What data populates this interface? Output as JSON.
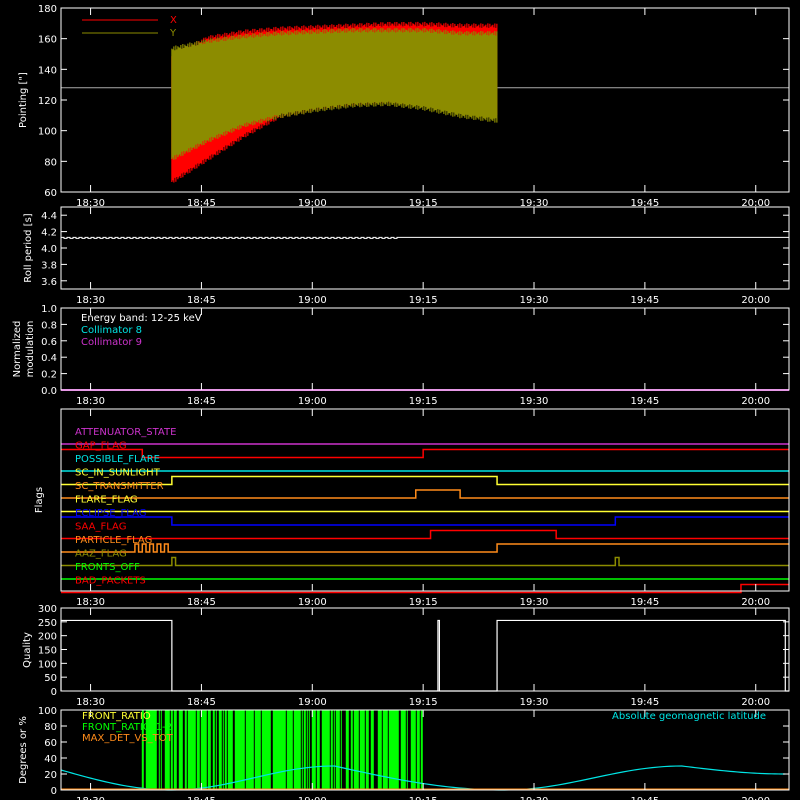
{
  "colors": {
    "background": "#000000",
    "axes": "#ffffff",
    "red": "#ff0000",
    "olive": "#8c8c00",
    "cyan": "#00e5e5",
    "magenta": "#cc33cc",
    "green": "#00ff00",
    "orange": "#ff8c1a",
    "yellow": "#ffff33",
    "blue": "#0000ff",
    "gray": "#aaaaaa"
  },
  "time_ticks": [
    "18:30",
    "18:45",
    "19:00",
    "19:15",
    "19:30",
    "19:45",
    "20:00"
  ],
  "chart_data": [
    {
      "type": "line",
      "ylabel": "Pointing [\"]",
      "ylim": [
        60,
        180
      ],
      "yticks": [
        "60",
        "80",
        "100",
        "120",
        "140",
        "160",
        "180"
      ],
      "legend": [
        "X",
        "Y"
      ],
      "reference_level": 128,
      "x_start": "18:41",
      "x_end": "19:25",
      "series": [
        {
          "name": "X",
          "color": "red",
          "low": [
            65,
            80,
            95,
            108,
            113,
            116,
            118,
            116,
            112,
            110
          ],
          "high": [
            150,
            162,
            166,
            168,
            169,
            170,
            171,
            171,
            170,
            170
          ]
        },
        {
          "name": "Y",
          "color": "olive",
          "low": [
            80,
            92,
            102,
            108,
            112,
            115,
            116,
            113,
            108,
            105
          ],
          "high": [
            155,
            160,
            163,
            165,
            166,
            167,
            167,
            167,
            165,
            165
          ]
        }
      ]
    },
    {
      "type": "line",
      "ylabel": "Roll period [s]",
      "ylim": [
        3.5,
        4.5
      ],
      "yticks": [
        "3.6",
        "3.8",
        "4.0",
        "4.2",
        "4.4"
      ],
      "value": 4.13
    },
    {
      "type": "line",
      "ylabel": "Normalized modulation",
      "ylabel_lines": [
        "Normalized",
        "modulation"
      ],
      "ylim": [
        0,
        1
      ],
      "yticks": [
        "0.0",
        "0.2",
        "0.4",
        "0.6",
        "0.8",
        "1.0"
      ],
      "legend": [
        "Energy band: 12-25 keV",
        "Collimator 8",
        "Collimator 9"
      ],
      "value": 0
    },
    {
      "type": "line",
      "ylabel": "Flags",
      "flags": [
        {
          "name": "ATTENUATOR_STATE",
          "color": "magenta",
          "transitions": []
        },
        {
          "name": "GAP_FLAG",
          "color": "red",
          "transitions": [
            "18:37",
            "19:15"
          ],
          "initial": 1
        },
        {
          "name": "POSSIBLE_FLARE",
          "color": "cyan",
          "transitions": []
        },
        {
          "name": "SC_IN_SUNLIGHT",
          "color": "yellow",
          "transitions": [
            "18:41",
            "19:25"
          ],
          "initial": 0
        },
        {
          "name": "SC_TRANSMITTER",
          "color": "orange",
          "transitions": [
            "19:14",
            "19:20"
          ],
          "initial": 0
        },
        {
          "name": "FLARE_FLAG",
          "color": "yellow",
          "transitions": []
        },
        {
          "name": "ECLIPSE_FLAG",
          "color": "blue",
          "transitions": [
            "18:41",
            "19:41"
          ],
          "initial": 1
        },
        {
          "name": "SAA_FLAG",
          "color": "red",
          "transitions": [
            "19:16",
            "19:33"
          ],
          "initial": 0
        },
        {
          "name": "PARTICLE_FLAG",
          "color": "orange",
          "transitions": [
            "18:36",
            "18:36.5",
            "18:37",
            "18:37.5",
            "18:38",
            "18:38.5",
            "18:39",
            "18:39.5",
            "18:40",
            "18:40.5",
            "19:25"
          ],
          "initial": 0
        },
        {
          "name": "AAZ_FLAG",
          "color": "olive",
          "transitions": [
            "18:41",
            "18:41.5",
            "19:41",
            "19:41.5"
          ],
          "initial": 0
        },
        {
          "name": "FRONTS_OFF",
          "color": "green",
          "transitions": []
        },
        {
          "name": "BAD_PACKETS",
          "color": "red",
          "transitions": [
            "19:58"
          ],
          "initial": 0
        }
      ]
    },
    {
      "type": "line",
      "ylabel": "Quality",
      "ylim": [
        0,
        300
      ],
      "yticks": [
        "0",
        "50",
        "100",
        "150",
        "200",
        "250",
        "300"
      ],
      "segments": [
        {
          "from": "18:26",
          "to": "18:41",
          "value": 255
        },
        {
          "from": "19:17",
          "to": "19:17.2",
          "value": 255
        },
        {
          "from": "19:25",
          "to": "20:04",
          "value": 255
        }
      ]
    },
    {
      "type": "line",
      "ylabel": "Degrees or %",
      "ylim": [
        0,
        100
      ],
      "yticks": [
        "0",
        "20",
        "40",
        "60",
        "80",
        "100"
      ],
      "legend": [
        "FRONT_RATIO",
        "FRONT_RATIO_1-2",
        "MAX_DET_VS_TOT"
      ],
      "annotation": "Absolute geomagnetic latitude",
      "latitude": {
        "times": [
          "18:26",
          "18:41",
          "19:03",
          "19:26",
          "19:50",
          "20:04"
        ],
        "values": [
          25,
          0,
          30,
          0,
          30,
          20
        ]
      },
      "front_ratio_span": [
        "18:37",
        "19:15"
      ]
    }
  ]
}
